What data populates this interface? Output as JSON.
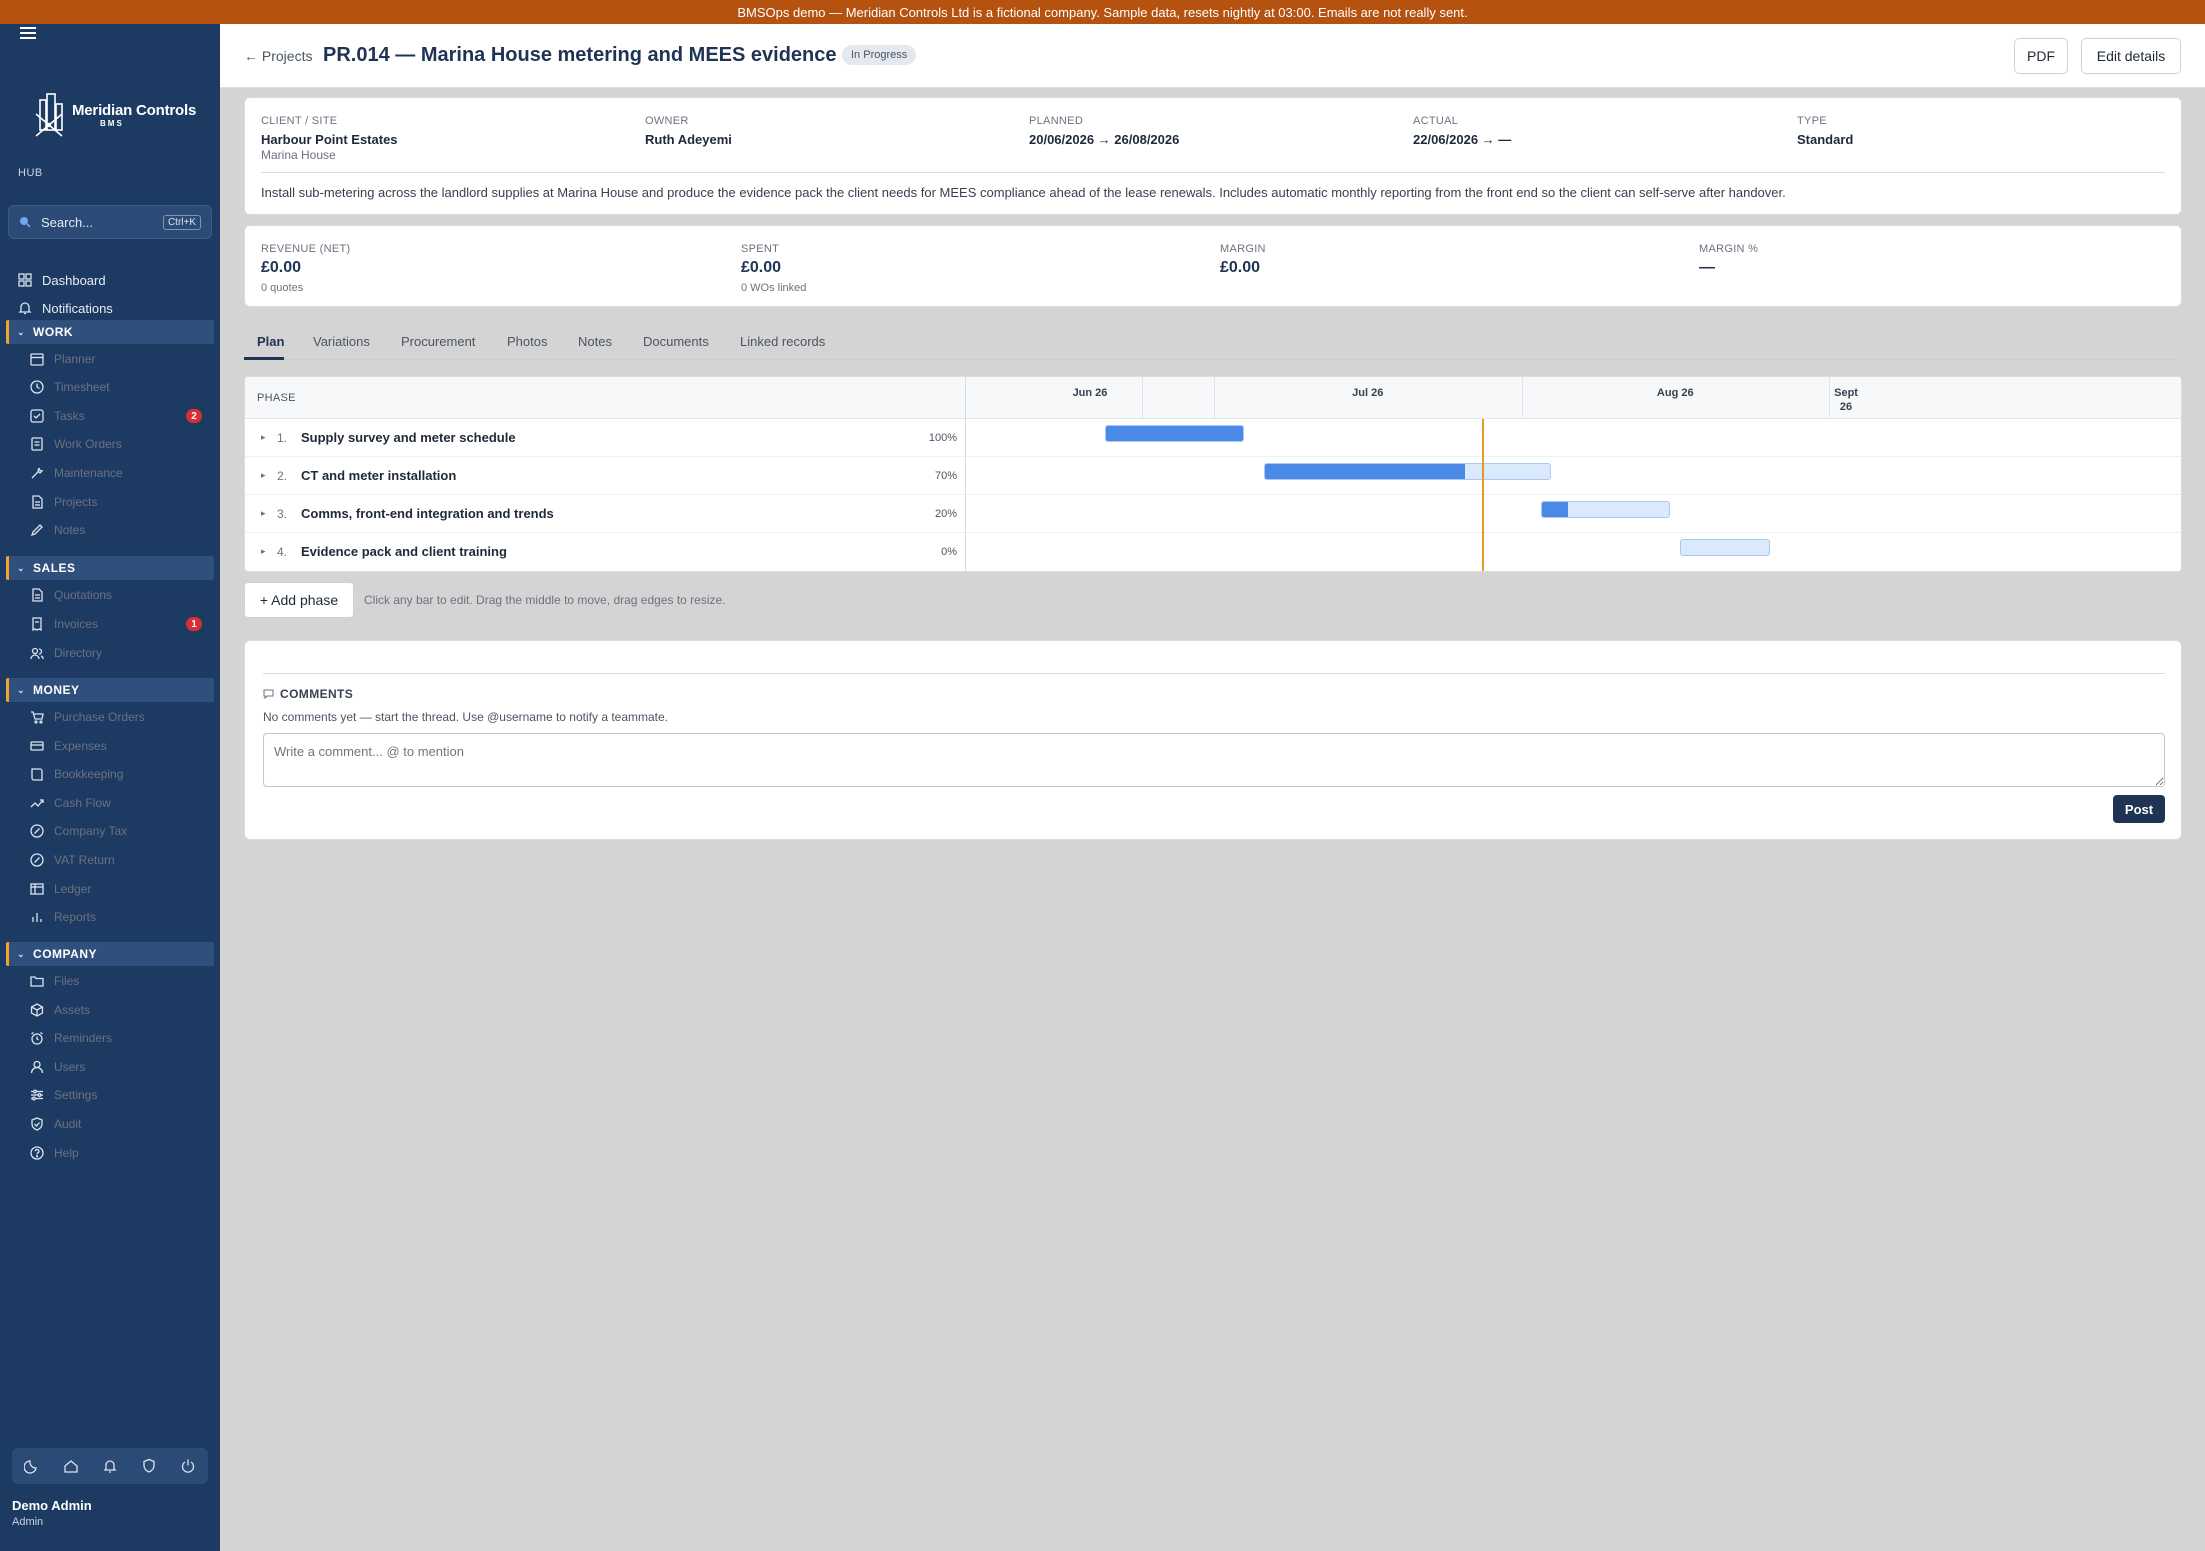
{
  "banner": "BMSOps demo — Meridian Controls Ltd is a fictional company. Sample data, resets nightly at 03:00. Emails are not really sent.",
  "sidebar": {
    "brand_name": "Meridian Controls",
    "brand_sub": "BMS",
    "hub_label": "HUB",
    "search": {
      "label": "Search...",
      "shortcut": "Ctrl+K"
    },
    "top_items": [
      {
        "label": "Dashboard",
        "icon": "grid-icon"
      },
      {
        "label": "Notifications",
        "icon": "bell-icon"
      }
    ],
    "sections": {
      "work": {
        "label": "WORK",
        "items": [
          {
            "label": "Planner",
            "icon": "calendar-icon"
          },
          {
            "label": "Timesheet",
            "icon": "clock-icon"
          },
          {
            "label": "Tasks",
            "icon": "checkbox-icon",
            "badge": "2"
          },
          {
            "label": "Work Orders",
            "icon": "clipboard-icon"
          },
          {
            "label": "Maintenance",
            "icon": "wrench-icon"
          },
          {
            "label": "Projects",
            "icon": "document-icon"
          },
          {
            "label": "Notes",
            "icon": "pencil-icon"
          }
        ]
      },
      "sales": {
        "label": "SALES",
        "items": [
          {
            "label": "Quotations",
            "icon": "document-icon"
          },
          {
            "label": "Invoices",
            "icon": "receipt-icon",
            "badge": "1"
          },
          {
            "label": "Directory",
            "icon": "people-icon"
          }
        ]
      },
      "money": {
        "label": "MONEY",
        "items": [
          {
            "label": "Purchase Orders",
            "icon": "cart-icon"
          },
          {
            "label": "Expenses",
            "icon": "card-icon"
          },
          {
            "label": "Bookkeeping",
            "icon": "book-icon"
          },
          {
            "label": "Cash Flow",
            "icon": "trend-icon"
          },
          {
            "label": "Company Tax",
            "icon": "percent-icon"
          },
          {
            "label": "VAT Return",
            "icon": "percent-icon"
          },
          {
            "label": "Ledger",
            "icon": "table-icon"
          },
          {
            "label": "Reports",
            "icon": "bar-chart-icon"
          }
        ]
      },
      "company": {
        "label": "COMPANY",
        "items": [
          {
            "label": "Files",
            "icon": "folder-icon"
          },
          {
            "label": "Assets",
            "icon": "cube-icon"
          },
          {
            "label": "Reminders",
            "icon": "alarm-icon"
          },
          {
            "label": "Users",
            "icon": "user-icon"
          },
          {
            "label": "Settings",
            "icon": "sliders-icon"
          },
          {
            "label": "Audit",
            "icon": "shield-icon"
          },
          {
            "label": "Help",
            "icon": "help-icon"
          }
        ]
      }
    },
    "footer_icons": [
      "moon-icon",
      "home-icon",
      "bell-icon",
      "shield-icon",
      "power-icon"
    ],
    "user": {
      "name": "Demo Admin",
      "role": "Admin"
    }
  },
  "header": {
    "back_label": "← Projects",
    "title": "PR.014 — Marina House metering and MEES evidence",
    "status": "In Progress",
    "pdf_label": "PDF",
    "edit_label": "Edit details"
  },
  "info": {
    "client_label": "CLIENT / SITE",
    "client": "Harbour Point Estates",
    "site": "Marina House",
    "owner_label": "OWNER",
    "owner": "Ruth Adeyemi",
    "planned_label": "PLANNED",
    "planned": "20/06/2026 → 26/08/2026",
    "actual_label": "ACTUAL",
    "actual": "22/06/2026 → —",
    "type_label": "TYPE",
    "type": "Standard",
    "description": "Install sub-metering across the landlord supplies at Marina House and produce the evidence pack the client needs for MEES compliance ahead of the lease renewals. Includes automatic monthly reporting from the front end so the client can self-serve after handover."
  },
  "finance": {
    "revenue_label": "REVENUE (NET)",
    "revenue": "£0.00",
    "revenue_sub": "0 quotes",
    "spent_label": "SPENT",
    "spent": "£0.00",
    "spent_sub": "0 WOs linked",
    "margin_label": "MARGIN",
    "margin": "£0.00",
    "margin_pct_label": "MARGIN %",
    "margin_pct": "—"
  },
  "tabs": [
    "Plan",
    "Variations",
    "Procurement",
    "Photos",
    "Notes",
    "Documents",
    "Linked records"
  ],
  "gantt": {
    "phase_header": "PHASE",
    "months": [
      "Jun 26",
      "Jul 26",
      "Aug 26",
      "Sept 26"
    ],
    "phases": [
      {
        "num": "1.",
        "name": "Supply survey and meter schedule",
        "pct_label": "100%",
        "progress": 1.0,
        "start": "2026-06-20",
        "end": "2026-07-04"
      },
      {
        "num": "2.",
        "name": "CT and meter installation",
        "pct_label": "70%",
        "progress": 0.7,
        "start": "2026-07-06",
        "end": "2026-08-04"
      },
      {
        "num": "3.",
        "name": "Comms, front-end integration and trends",
        "pct_label": "20%",
        "progress": 0.2,
        "start": "2026-08-03",
        "end": "2026-08-16"
      },
      {
        "num": "4.",
        "name": "Evidence pack and client training",
        "pct_label": "0%",
        "progress": 0.0,
        "start": "2026-08-17",
        "end": "2026-08-26"
      }
    ]
  },
  "plan_actions": {
    "add_phase": "+ Add phase",
    "hint": "Click any bar to edit. Drag the middle to move, drag edges to resize."
  },
  "comments": {
    "title": "COMMENTS",
    "empty": "No comments yet — start the thread. Use @username to notify a teammate.",
    "placeholder": "Write a comment... @ to mention",
    "post_label": "Post"
  }
}
